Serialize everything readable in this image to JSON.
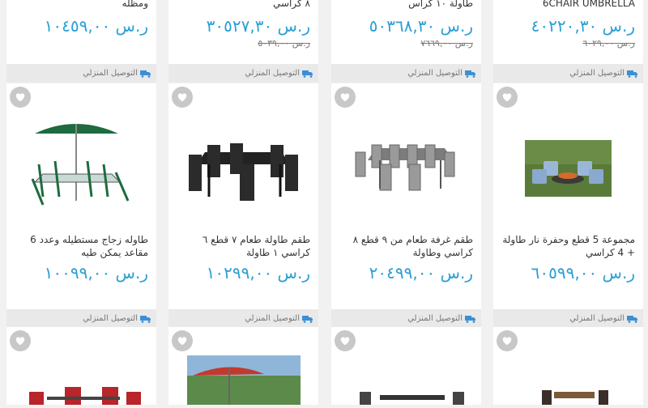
{
  "delivery_label": "التوصيل المنزلي",
  "row1": [
    {
      "title": "6CHAIR UMBRELLA",
      "price": "ر.س ٤٠٢٢٠,٣٠",
      "old_price": "ر.س ٦٠٢٩,٠٠"
    },
    {
      "title": "طاولة ١٠ كراس",
      "price": "ر.س ٥٠٣٦٨,٣٠",
      "old_price": "ر.س ٧٦٦٩,٠٠"
    },
    {
      "title": "٨ كراسي",
      "price": "ر.س ٣٠٥٢٧,٣٠",
      "old_price": "ر.س ٥٠٣٩,٠٠"
    },
    {
      "title": "ومظله",
      "price": "ر.س ١٠٤٥٩,٠٠",
      "old_price": ""
    }
  ],
  "row2": [
    {
      "title": "مجموعة 5 قطع وحفرة نار طاولة + 4 كراسي",
      "price": "ر.س ٦٠٥٩٩,٠٠"
    },
    {
      "title": "طقم غرفة طعام من ٩ قطع ٨ كراسي وطاولة",
      "price": "ر.س ٢٠٤٩٩,٠٠"
    },
    {
      "title": "طقم طاولة طعام ٧ قطع ٦ كراسي ١ طاولة",
      "price": "ر.س ١٠٢٩٩,٠٠"
    },
    {
      "title": "طاوله زجاج مستطيله وعدد 6 مقاعد يمكن طيه",
      "price": "ر.س ١٠٠٩٩,٠٠"
    }
  ],
  "icons": {
    "favorite": "heart-icon",
    "delivery": "truck-icon"
  },
  "colors": {
    "price": "#2a9fd6",
    "fav_bg": "#c8c8c8",
    "delivery_bg": "#e9e9e9"
  }
}
